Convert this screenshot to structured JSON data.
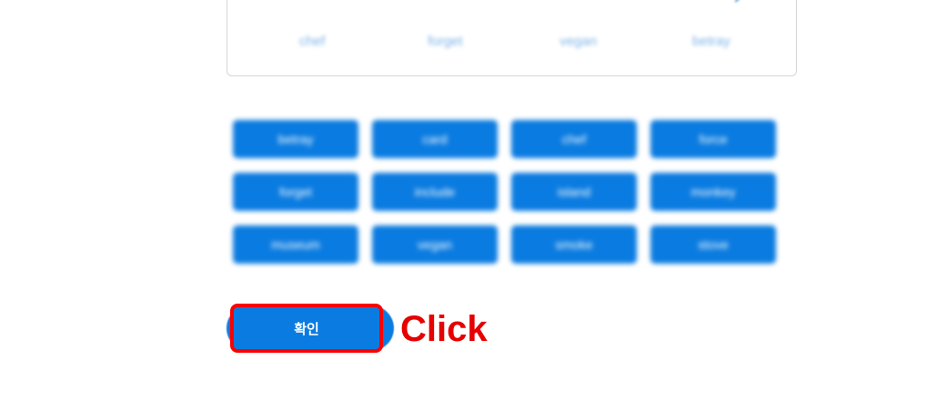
{
  "seed_card": {
    "words": [
      "chef",
      "forget",
      "vegan",
      "betray"
    ]
  },
  "word_buttons": [
    "betray",
    "card",
    "chef",
    "force",
    "forget",
    "include",
    "island",
    "monkey",
    "museum",
    "vegan",
    "smoke",
    "stove"
  ],
  "confirm": {
    "label": "확인"
  },
  "annotation": {
    "label": "Click"
  },
  "colors": {
    "accent": "#0a7be0",
    "highlight": "#ff0000"
  }
}
